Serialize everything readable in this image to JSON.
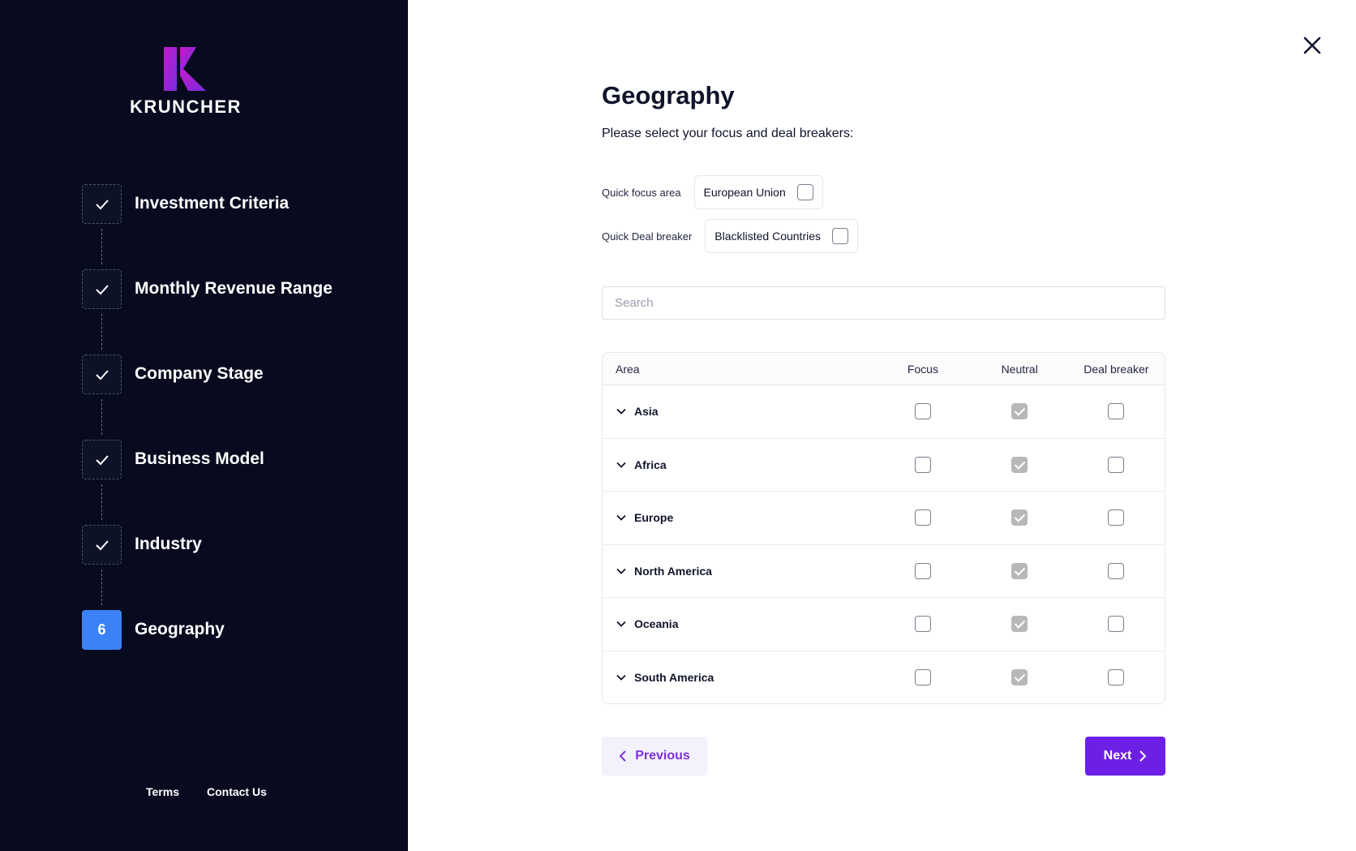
{
  "brand": {
    "name": "KRUNCHER",
    "logo_colors": [
      "#c21cc9",
      "#7a2ce0"
    ]
  },
  "steps": [
    {
      "label": "Investment Criteria",
      "status": "done"
    },
    {
      "label": "Monthly Revenue Range",
      "status": "done"
    },
    {
      "label": "Company Stage",
      "status": "done"
    },
    {
      "label": "Business Model",
      "status": "done"
    },
    {
      "label": "Industry",
      "status": "done"
    },
    {
      "label": "Geography",
      "status": "active",
      "number": "6"
    }
  ],
  "footer": {
    "terms": "Terms",
    "contact": "Contact Us"
  },
  "page": {
    "title": "Geography",
    "subtitle": "Please select your focus and deal breakers:",
    "quick_focus": {
      "label": "Quick focus area",
      "option": "European Union",
      "checked": false
    },
    "quick_deal": {
      "label": "Quick Deal breaker",
      "option": "Blacklisted Countries",
      "checked": false
    },
    "search_placeholder": "Search"
  },
  "table": {
    "headers": {
      "area": "Area",
      "focus": "Focus",
      "neutral": "Neutral",
      "deal": "Deal breaker"
    },
    "rows": [
      {
        "name": "Asia",
        "selection": "neutral"
      },
      {
        "name": "Africa",
        "selection": "neutral"
      },
      {
        "name": "Europe",
        "selection": "neutral"
      },
      {
        "name": "North America",
        "selection": "neutral"
      },
      {
        "name": "Oceania",
        "selection": "neutral"
      },
      {
        "name": "South America",
        "selection": "neutral"
      }
    ]
  },
  "buttons": {
    "previous": "Previous",
    "next": "Next"
  },
  "colors": {
    "sidebar": "#080b1f",
    "active_step": "#3b82f6",
    "primary": "#6d1fe6",
    "secondary_bg": "#f3f1fc"
  }
}
